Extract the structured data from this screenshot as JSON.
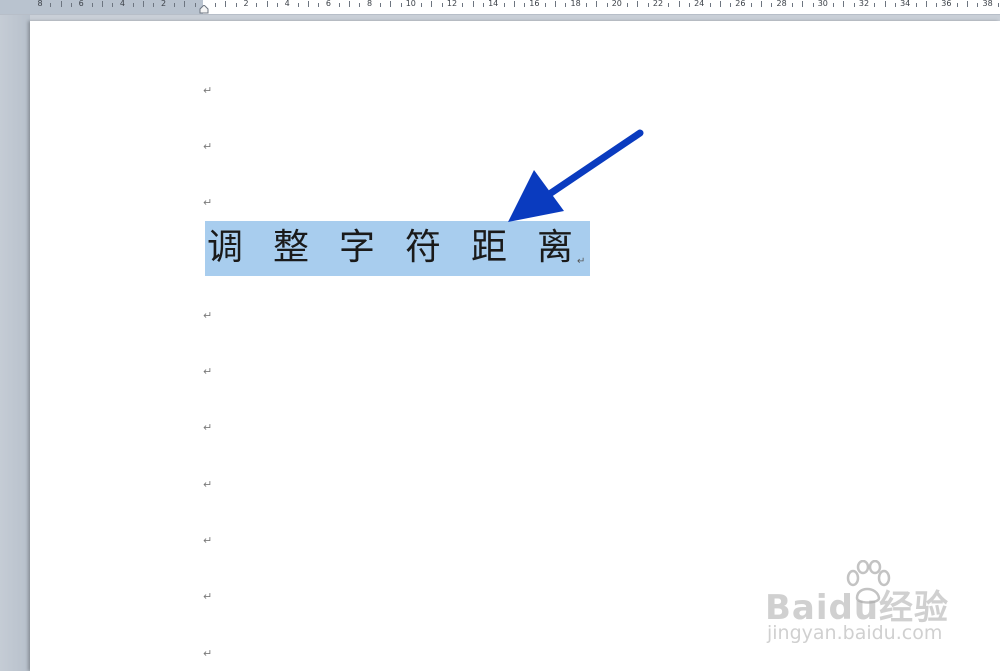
{
  "ruler": {
    "labels": [
      "8",
      "6",
      "4",
      "2",
      "",
      "2",
      "4",
      "6",
      "8",
      "10",
      "12",
      "14",
      "16",
      "18",
      "20",
      "22",
      "24",
      "26",
      "28",
      "30",
      "32",
      "34",
      "36",
      "38"
    ]
  },
  "document": {
    "heading_text": "调整字符距离",
    "paragraph_mark": "↵",
    "selection_color": "#a8cdee"
  },
  "annotation": {
    "arrow_color": "#0a3bbf"
  },
  "watermark": {
    "brand": "Baidu经验",
    "url": "jingyan.baidu.com"
  }
}
